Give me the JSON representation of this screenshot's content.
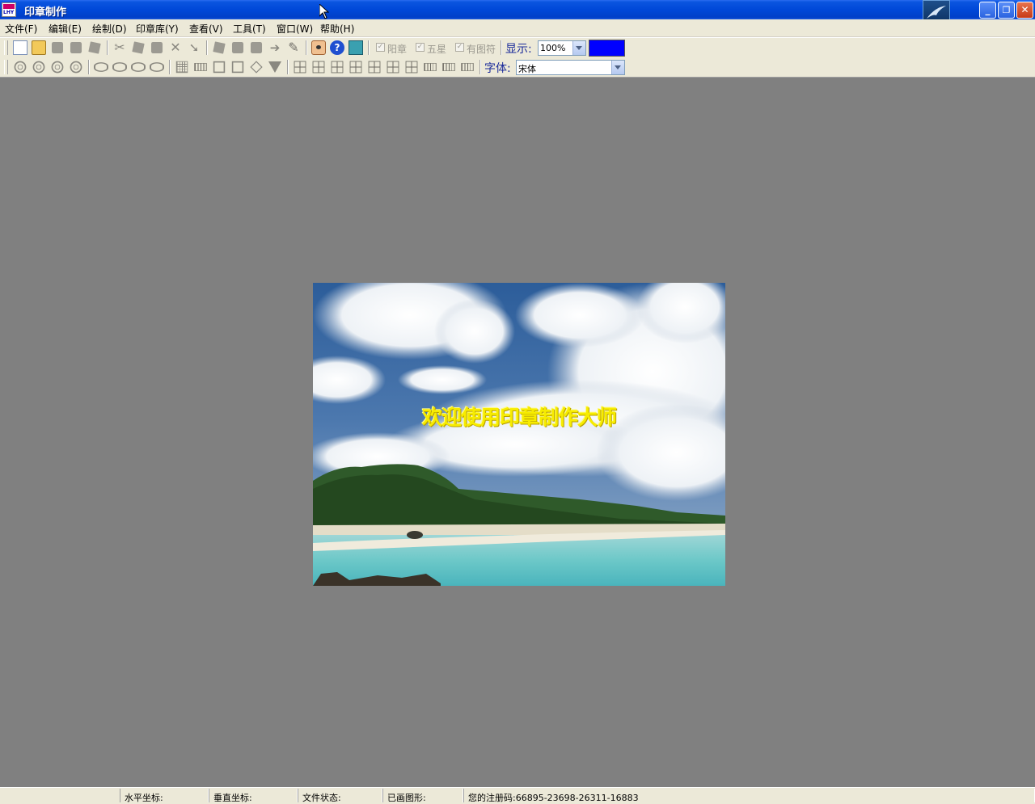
{
  "window": {
    "title": "印章制作",
    "app_icon": "stamp-app-icon",
    "controls": [
      "minimize-icon",
      "restore-icon",
      "close-icon"
    ],
    "control_glyphs": {
      "minimize": "_",
      "restore": "❐",
      "close": "✕"
    }
  },
  "menu": [
    {
      "label": "文件(F)"
    },
    {
      "label": "编辑(E)"
    },
    {
      "label": "绘制(D)"
    },
    {
      "label": "印章库(Y)"
    },
    {
      "label": "查看(V)"
    },
    {
      "label": "工具(T)"
    },
    {
      "label": "窗口(W)"
    },
    {
      "label": "帮助(H)"
    }
  ],
  "toolbar1": {
    "icons": [
      "new-document-icon",
      "open-folder-icon",
      "save-icon",
      "save-as-icon",
      "print-icon",
      "cut-icon",
      "copy-icon",
      "paste-icon",
      "delete-icon",
      "arrow-icon",
      "group-icon",
      "ungroup-icon",
      "layer-up-icon",
      "layer-down-icon",
      "edit-icon",
      "preview-eye-icon",
      "help-icon",
      "exit-icon"
    ],
    "checkboxes": [
      {
        "label": "阳章",
        "checked": true,
        "glyph": "✓"
      },
      {
        "label": "五星",
        "checked": true,
        "glyph": "✓"
      },
      {
        "label": "有图符",
        "checked": true,
        "glyph": "✓"
      }
    ],
    "zoom_label": "显示:",
    "zoom_value": "100%",
    "current_color": "#0000ff"
  },
  "toolbar2": {
    "icons": [
      "round-stamp-1-icon",
      "round-stamp-2-icon",
      "round-stamp-3-icon",
      "round-stamp-4-icon",
      "oval-stamp-1-icon",
      "oval-stamp-2-icon",
      "oval-stamp-3-icon",
      "oval-stamp-4-icon",
      "grid-icon",
      "rectangle-bar-icon",
      "square-stamp-icon",
      "square-frame-icon",
      "diamond-icon",
      "triangle-icon",
      "layout-1-icon",
      "layout-2-icon",
      "layout-3-icon",
      "layout-4-icon",
      "layout-5-icon",
      "layout-6-icon",
      "layout-7-icon",
      "layout-8-icon",
      "layout-9-icon",
      "layout-10-icon"
    ],
    "font_label": "字体:",
    "font_value": "宋体"
  },
  "canvas": {
    "background_color": "#808080",
    "welcome_text": "欢迎使用印章制作大师",
    "image_subject": "beach-landscape"
  },
  "statusbar": {
    "panes": [
      {
        "label": "水平坐标:"
      },
      {
        "label": "垂直坐标:"
      },
      {
        "label": "文件状态:"
      },
      {
        "label": "已画图形:"
      },
      {
        "label": "您的注册码:66895-23698-26311-16883"
      }
    ]
  }
}
